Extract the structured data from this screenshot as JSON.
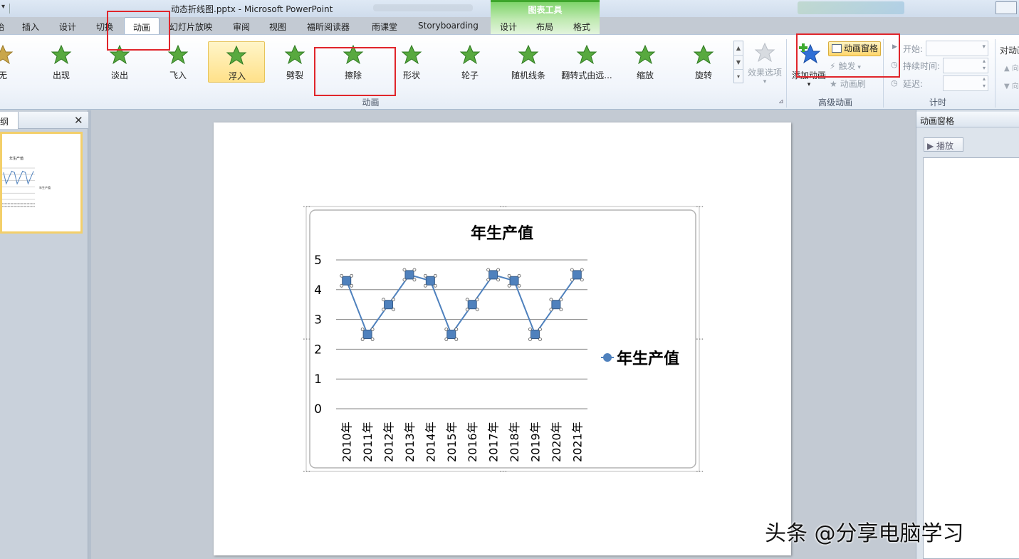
{
  "titlebar": {
    "title": "动态折线图.pptx - Microsoft PowerPoint",
    "context_group": "图表工具"
  },
  "tabs": [
    {
      "label": "插入"
    },
    {
      "label": "设计"
    },
    {
      "label": "切换"
    },
    {
      "label": "动画",
      "active": true
    },
    {
      "label": "幻灯片放映"
    },
    {
      "label": "审阅"
    },
    {
      "label": "视图"
    },
    {
      "label": "福昕阅读器"
    },
    {
      "label": "雨课堂"
    },
    {
      "label": "Storyboarding"
    },
    {
      "label": "设计"
    },
    {
      "label": "布局"
    },
    {
      "label": "格式"
    }
  ],
  "ribbon": {
    "animations": [
      {
        "label": "无",
        "icon": "star-none-icon"
      },
      {
        "label": "出现",
        "icon": "star-appear-icon"
      },
      {
        "label": "淡出",
        "icon": "star-fade-icon"
      },
      {
        "label": "飞入",
        "icon": "star-fly-in-icon"
      },
      {
        "label": "浮入",
        "icon": "star-float-in-icon",
        "selected": true
      },
      {
        "label": "劈裂",
        "icon": "star-split-icon"
      },
      {
        "label": "擦除",
        "icon": "star-wipe-icon"
      },
      {
        "label": "形状",
        "icon": "star-shape-icon"
      },
      {
        "label": "轮子",
        "icon": "star-wheel-icon"
      },
      {
        "label": "随机线条",
        "icon": "star-random-bars-icon"
      },
      {
        "label": "翻转式由远...",
        "icon": "star-grow-turn-icon"
      },
      {
        "label": "缩放",
        "icon": "star-zoom-icon"
      },
      {
        "label": "旋转",
        "icon": "star-swivel-icon"
      }
    ],
    "effect_options": "效果选项",
    "group_animation": "动画",
    "add_animation": "添加动画",
    "animation_pane": "动画窗格",
    "trigger": "触发",
    "animation_painter": "动画刷",
    "group_advanced": "高级动画",
    "timing": {
      "start_label": "开始:",
      "duration_label": "持续时间:",
      "delay_label": "延迟:"
    },
    "group_timing": "计时",
    "reorder": "对动画"
  },
  "left_panel": {
    "tab_label": "纲",
    "thumb_chart_title": "年生产值",
    "thumb_legend": "年生产值"
  },
  "right_pane": {
    "title": "动画窗格",
    "play_label": "▶ 播放"
  },
  "watermark": "头条 @分享电脑学习",
  "colors": {
    "series": "#4f81bd",
    "highlight": "#e0252b",
    "selected": "#ffd66b"
  },
  "chart_data": {
    "type": "line",
    "title": "年生产值",
    "categories": [
      "2010年",
      "2011年",
      "2012年",
      "2013年",
      "2014年",
      "2015年",
      "2016年",
      "2017年",
      "2018年",
      "2019年",
      "2020年",
      "2021年"
    ],
    "series": [
      {
        "name": "年生产值",
        "values": [
          4.3,
          2.5,
          3.5,
          4.5,
          4.3,
          2.5,
          3.5,
          4.5,
          4.3,
          2.5,
          3.5,
          4.5
        ]
      }
    ],
    "yticks": [
      "0",
      "1",
      "2",
      "3",
      "4",
      "5"
    ],
    "ylim": [
      0,
      5
    ],
    "grid": true,
    "legend": "right",
    "xlabel": "",
    "ylabel": ""
  }
}
